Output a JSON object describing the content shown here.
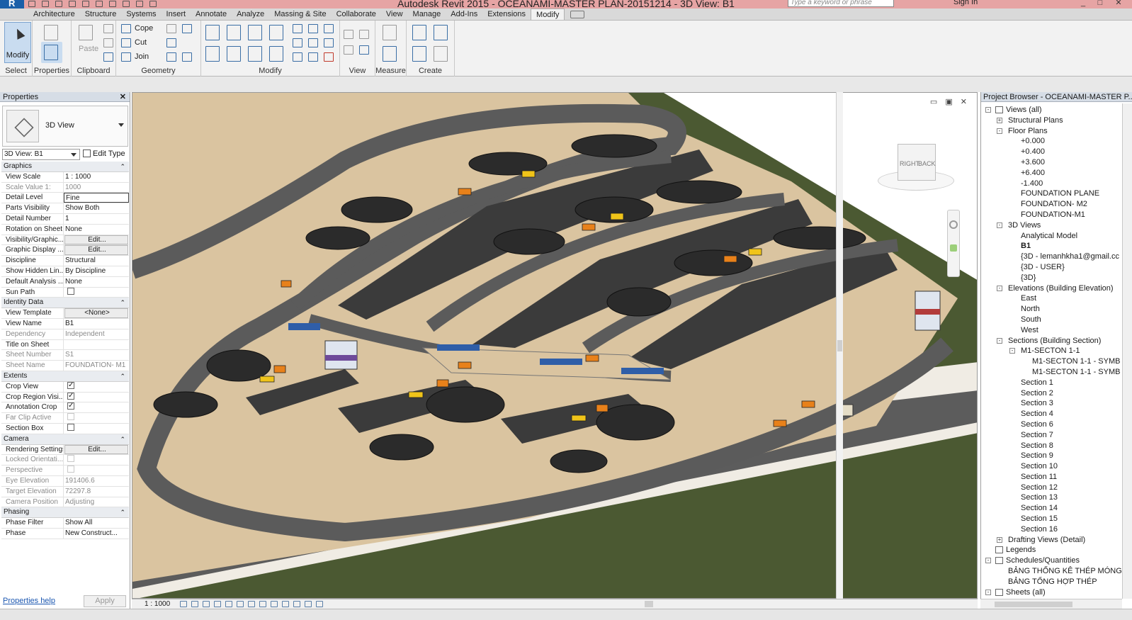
{
  "titlebar": {
    "title": "Autodesk Revit 2015 -    OCEANAMI-MASTER PLAN-20151214 - 3D View: B1",
    "search_placeholder": "Type a keyword or phrase",
    "signin": "Sign In",
    "app_letter": "R"
  },
  "tabs": [
    "Architecture",
    "Structure",
    "Systems",
    "Insert",
    "Annotate",
    "Analyze",
    "Massing & Site",
    "Collaborate",
    "View",
    "Manage",
    "Add-Ins",
    "Extensions",
    "Modify"
  ],
  "active_tab": "Modify",
  "ribbon": {
    "modify_label": "Modify",
    "paste_label": "Paste",
    "cope_label": "Cope",
    "cut_label": "Cut",
    "join_label": "Join",
    "panels": {
      "select": "Select",
      "properties": "Properties",
      "clipboard": "Clipboard",
      "geometry": "Geometry",
      "modify": "Modify",
      "view": "View",
      "measure": "Measure",
      "create": "Create"
    }
  },
  "properties": {
    "title": "Properties",
    "type_name": "3D View",
    "instance_selector": "3D View: B1",
    "edit_type": "Edit Type",
    "groups": [
      {
        "name": "Graphics",
        "rows": [
          {
            "k": "View Scale",
            "v": "1 : 1000"
          },
          {
            "k": "Scale Value    1:",
            "v": "1000",
            "dim": true
          },
          {
            "k": "Detail Level",
            "v": "Fine",
            "sel": true
          },
          {
            "k": "Parts Visibility",
            "v": "Show Both"
          },
          {
            "k": "Detail Number",
            "v": "1"
          },
          {
            "k": "Rotation on Sheet",
            "v": "None"
          },
          {
            "k": "Visibility/Graphic...",
            "v": "Edit...",
            "btn": true
          },
          {
            "k": "Graphic Display ...",
            "v": "Edit...",
            "btn": true
          },
          {
            "k": "Discipline",
            "v": "Structural"
          },
          {
            "k": "Show Hidden Lin...",
            "v": "By Discipline"
          },
          {
            "k": "Default Analysis ...",
            "v": "None"
          },
          {
            "k": "Sun Path",
            "v": "",
            "cb": "off"
          }
        ]
      },
      {
        "name": "Identity Data",
        "rows": [
          {
            "k": "View Template",
            "v": "<None>",
            "btn": true
          },
          {
            "k": "View Name",
            "v": "B1"
          },
          {
            "k": "Dependency",
            "v": "Independent",
            "dim": true
          },
          {
            "k": "Title on Sheet",
            "v": ""
          },
          {
            "k": "Sheet Number",
            "v": "S1",
            "dim": true
          },
          {
            "k": "Sheet Name",
            "v": "FOUNDATION- M1",
            "dim": true
          }
        ]
      },
      {
        "name": "Extents",
        "rows": [
          {
            "k": "Crop View",
            "v": "",
            "cb": "on"
          },
          {
            "k": "Crop Region Visi...",
            "v": "",
            "cb": "on"
          },
          {
            "k": "Annotation Crop",
            "v": "",
            "cb": "on"
          },
          {
            "k": "Far Clip Active",
            "v": "",
            "cb": "dis",
            "dim": true
          },
          {
            "k": "Section Box",
            "v": "",
            "cb": "off"
          }
        ]
      },
      {
        "name": "Camera",
        "rows": [
          {
            "k": "Rendering Settings",
            "v": "Edit...",
            "btn": true
          },
          {
            "k": "Locked Orientati...",
            "v": "",
            "cb": "dis",
            "dim": true
          },
          {
            "k": "Perspective",
            "v": "",
            "cb": "dis",
            "dim": true
          },
          {
            "k": "Eye Elevation",
            "v": "191406.6",
            "dim": true
          },
          {
            "k": "Target Elevation",
            "v": "72297.8",
            "dim": true
          },
          {
            "k": "Camera Position",
            "v": "Adjusting",
            "dim": true
          }
        ]
      },
      {
        "name": "Phasing",
        "rows": [
          {
            "k": "Phase Filter",
            "v": "Show All"
          },
          {
            "k": "Phase",
            "v": "New Construct..."
          }
        ]
      }
    ],
    "help_link": "Properties help",
    "apply_label": "Apply"
  },
  "view": {
    "scale": "1 : 1000",
    "cube_right": "RIGHT",
    "cube_back": "BACK"
  },
  "browser": {
    "title": "Project Browser - OCEANAMI-MASTER P...",
    "nodes": [
      {
        "t": "Views (all)",
        "lvl": 0,
        "tg": "-",
        "icon": true
      },
      {
        "t": "Structural Plans",
        "lvl": 1,
        "tg": "+"
      },
      {
        "t": "Floor Plans",
        "lvl": 1,
        "tg": "-"
      },
      {
        "t": "+0.000",
        "lvl": 2
      },
      {
        "t": "+0.400",
        "lvl": 2
      },
      {
        "t": "+3.600",
        "lvl": 2
      },
      {
        "t": "+6.400",
        "lvl": 2
      },
      {
        "t": "-1.400",
        "lvl": 2
      },
      {
        "t": "FOUNDATION PLANE",
        "lvl": 2
      },
      {
        "t": "FOUNDATION- M2",
        "lvl": 2
      },
      {
        "t": "FOUNDATION-M1",
        "lvl": 2
      },
      {
        "t": "3D Views",
        "lvl": 1,
        "tg": "-"
      },
      {
        "t": "Analytical Model",
        "lvl": 2
      },
      {
        "t": "B1",
        "lvl": 2,
        "bold": true
      },
      {
        "t": "{3D - lemanhkha1@gmail.cc",
        "lvl": 2
      },
      {
        "t": "{3D - USER}",
        "lvl": 2
      },
      {
        "t": "{3D}",
        "lvl": 2
      },
      {
        "t": "Elevations (Building Elevation)",
        "lvl": 1,
        "tg": "-"
      },
      {
        "t": "East",
        "lvl": 2
      },
      {
        "t": "North",
        "lvl": 2
      },
      {
        "t": "South",
        "lvl": 2
      },
      {
        "t": "West",
        "lvl": 2
      },
      {
        "t": "Sections (Building Section)",
        "lvl": 1,
        "tg": "-"
      },
      {
        "t": "M1-SECTON 1-1",
        "lvl": 2,
        "tg": "-"
      },
      {
        "t": "M1-SECTON 1-1 - SYMB",
        "lvl": 3
      },
      {
        "t": "M1-SECTON 1-1 - SYMB",
        "lvl": 3
      },
      {
        "t": "Section 1",
        "lvl": 2
      },
      {
        "t": "Section 2",
        "lvl": 2
      },
      {
        "t": "Section 3",
        "lvl": 2
      },
      {
        "t": "Section 4",
        "lvl": 2
      },
      {
        "t": "Section 6",
        "lvl": 2
      },
      {
        "t": "Section 7",
        "lvl": 2
      },
      {
        "t": "Section 8",
        "lvl": 2
      },
      {
        "t": "Section 9",
        "lvl": 2
      },
      {
        "t": "Section 10",
        "lvl": 2
      },
      {
        "t": "Section 11",
        "lvl": 2
      },
      {
        "t": "Section 12",
        "lvl": 2
      },
      {
        "t": "Section 13",
        "lvl": 2
      },
      {
        "t": "Section 14",
        "lvl": 2
      },
      {
        "t": "Section 15",
        "lvl": 2
      },
      {
        "t": "Section 16",
        "lvl": 2
      },
      {
        "t": "Drafting Views (Detail)",
        "lvl": 1,
        "tg": "+"
      },
      {
        "t": "Legends",
        "lvl": 0,
        "icon": true
      },
      {
        "t": "Schedules/Quantities",
        "lvl": 0,
        "tg": "-",
        "icon": true
      },
      {
        "t": "BẢNG THỐNG KÊ THÉP MÓNG M",
        "lvl": 1
      },
      {
        "t": "BẢNG TỔNG HỢP THÉP",
        "lvl": 1
      },
      {
        "t": "Sheets (all)",
        "lvl": 0,
        "tg": "-",
        "icon": true
      }
    ]
  }
}
